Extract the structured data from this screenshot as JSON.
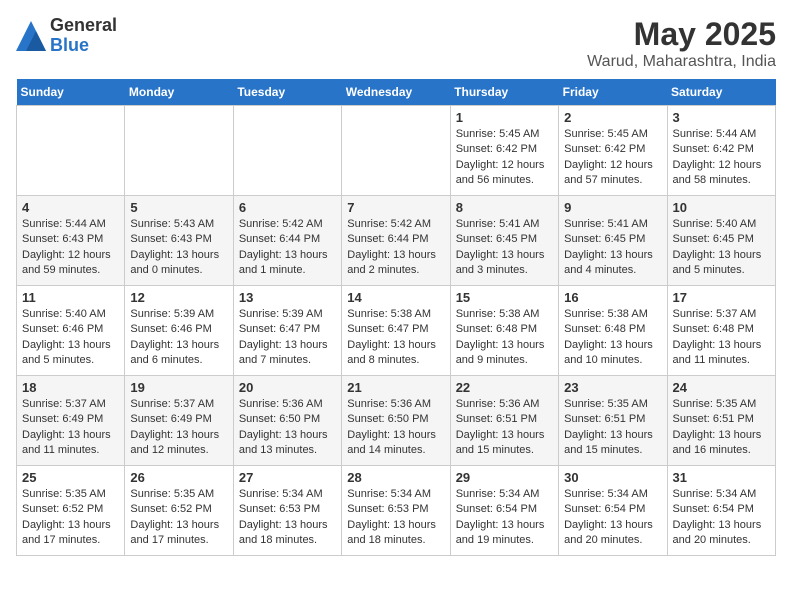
{
  "logo": {
    "general": "General",
    "blue": "Blue"
  },
  "title": "May 2025",
  "subtitle": "Warud, Maharashtra, India",
  "days_header": [
    "Sunday",
    "Monday",
    "Tuesday",
    "Wednesday",
    "Thursday",
    "Friday",
    "Saturday"
  ],
  "weeks": [
    [
      {
        "day": "",
        "info": ""
      },
      {
        "day": "",
        "info": ""
      },
      {
        "day": "",
        "info": ""
      },
      {
        "day": "",
        "info": ""
      },
      {
        "day": "1",
        "info": "Sunrise: 5:45 AM\nSunset: 6:42 PM\nDaylight: 12 hours\nand 56 minutes."
      },
      {
        "day": "2",
        "info": "Sunrise: 5:45 AM\nSunset: 6:42 PM\nDaylight: 12 hours\nand 57 minutes."
      },
      {
        "day": "3",
        "info": "Sunrise: 5:44 AM\nSunset: 6:42 PM\nDaylight: 12 hours\nand 58 minutes."
      }
    ],
    [
      {
        "day": "4",
        "info": "Sunrise: 5:44 AM\nSunset: 6:43 PM\nDaylight: 12 hours\nand 59 minutes."
      },
      {
        "day": "5",
        "info": "Sunrise: 5:43 AM\nSunset: 6:43 PM\nDaylight: 13 hours\nand 0 minutes."
      },
      {
        "day": "6",
        "info": "Sunrise: 5:42 AM\nSunset: 6:44 PM\nDaylight: 13 hours\nand 1 minute."
      },
      {
        "day": "7",
        "info": "Sunrise: 5:42 AM\nSunset: 6:44 PM\nDaylight: 13 hours\nand 2 minutes."
      },
      {
        "day": "8",
        "info": "Sunrise: 5:41 AM\nSunset: 6:45 PM\nDaylight: 13 hours\nand 3 minutes."
      },
      {
        "day": "9",
        "info": "Sunrise: 5:41 AM\nSunset: 6:45 PM\nDaylight: 13 hours\nand 4 minutes."
      },
      {
        "day": "10",
        "info": "Sunrise: 5:40 AM\nSunset: 6:45 PM\nDaylight: 13 hours\nand 5 minutes."
      }
    ],
    [
      {
        "day": "11",
        "info": "Sunrise: 5:40 AM\nSunset: 6:46 PM\nDaylight: 13 hours\nand 5 minutes."
      },
      {
        "day": "12",
        "info": "Sunrise: 5:39 AM\nSunset: 6:46 PM\nDaylight: 13 hours\nand 6 minutes."
      },
      {
        "day": "13",
        "info": "Sunrise: 5:39 AM\nSunset: 6:47 PM\nDaylight: 13 hours\nand 7 minutes."
      },
      {
        "day": "14",
        "info": "Sunrise: 5:38 AM\nSunset: 6:47 PM\nDaylight: 13 hours\nand 8 minutes."
      },
      {
        "day": "15",
        "info": "Sunrise: 5:38 AM\nSunset: 6:48 PM\nDaylight: 13 hours\nand 9 minutes."
      },
      {
        "day": "16",
        "info": "Sunrise: 5:38 AM\nSunset: 6:48 PM\nDaylight: 13 hours\nand 10 minutes."
      },
      {
        "day": "17",
        "info": "Sunrise: 5:37 AM\nSunset: 6:48 PM\nDaylight: 13 hours\nand 11 minutes."
      }
    ],
    [
      {
        "day": "18",
        "info": "Sunrise: 5:37 AM\nSunset: 6:49 PM\nDaylight: 13 hours\nand 11 minutes."
      },
      {
        "day": "19",
        "info": "Sunrise: 5:37 AM\nSunset: 6:49 PM\nDaylight: 13 hours\nand 12 minutes."
      },
      {
        "day": "20",
        "info": "Sunrise: 5:36 AM\nSunset: 6:50 PM\nDaylight: 13 hours\nand 13 minutes."
      },
      {
        "day": "21",
        "info": "Sunrise: 5:36 AM\nSunset: 6:50 PM\nDaylight: 13 hours\nand 14 minutes."
      },
      {
        "day": "22",
        "info": "Sunrise: 5:36 AM\nSunset: 6:51 PM\nDaylight: 13 hours\nand 15 minutes."
      },
      {
        "day": "23",
        "info": "Sunrise: 5:35 AM\nSunset: 6:51 PM\nDaylight: 13 hours\nand 15 minutes."
      },
      {
        "day": "24",
        "info": "Sunrise: 5:35 AM\nSunset: 6:51 PM\nDaylight: 13 hours\nand 16 minutes."
      }
    ],
    [
      {
        "day": "25",
        "info": "Sunrise: 5:35 AM\nSunset: 6:52 PM\nDaylight: 13 hours\nand 17 minutes."
      },
      {
        "day": "26",
        "info": "Sunrise: 5:35 AM\nSunset: 6:52 PM\nDaylight: 13 hours\nand 17 minutes."
      },
      {
        "day": "27",
        "info": "Sunrise: 5:34 AM\nSunset: 6:53 PM\nDaylight: 13 hours\nand 18 minutes."
      },
      {
        "day": "28",
        "info": "Sunrise: 5:34 AM\nSunset: 6:53 PM\nDaylight: 13 hours\nand 18 minutes."
      },
      {
        "day": "29",
        "info": "Sunrise: 5:34 AM\nSunset: 6:54 PM\nDaylight: 13 hours\nand 19 minutes."
      },
      {
        "day": "30",
        "info": "Sunrise: 5:34 AM\nSunset: 6:54 PM\nDaylight: 13 hours\nand 20 minutes."
      },
      {
        "day": "31",
        "info": "Sunrise: 5:34 AM\nSunset: 6:54 PM\nDaylight: 13 hours\nand 20 minutes."
      }
    ]
  ]
}
